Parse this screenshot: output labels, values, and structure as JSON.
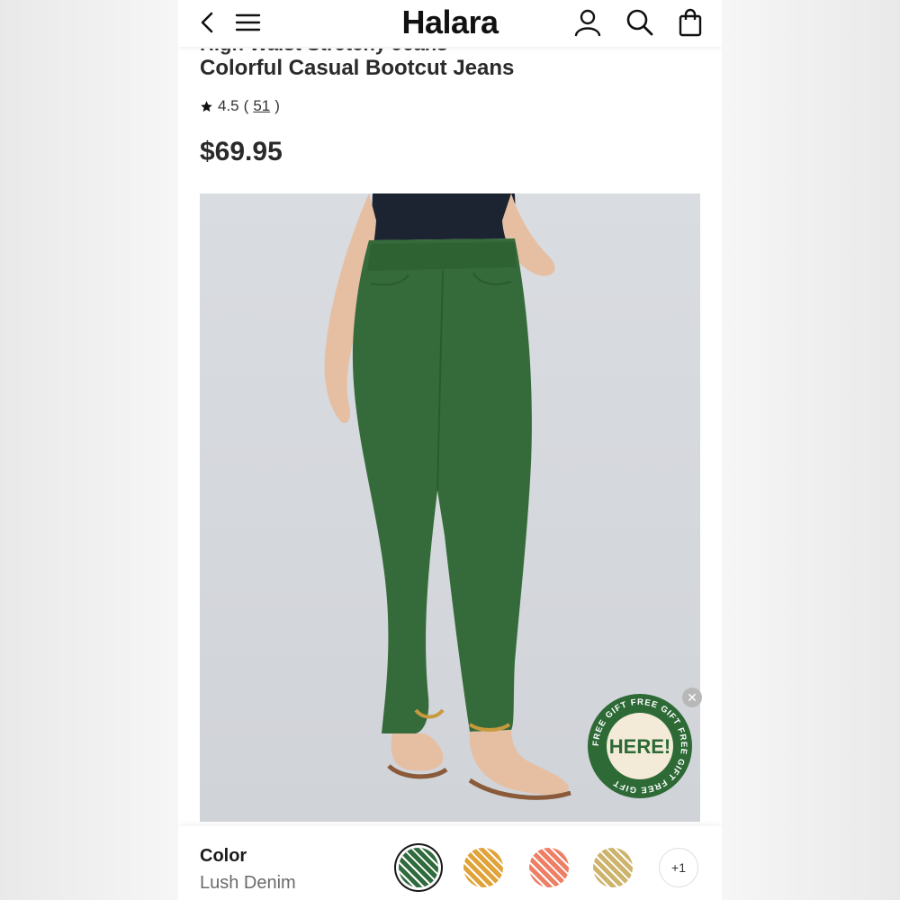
{
  "header": {
    "logo": "Halara"
  },
  "product": {
    "title_partial": "High Waist Stretchy Jeans",
    "title": "Colorful Casual Bootcut Jeans",
    "rating": "4.5",
    "rating_open": "(",
    "review_count": "51",
    "rating_close": ")",
    "price": "$69.95"
  },
  "promo": {
    "badge_text": "HERE!",
    "ring_text": "FREE GIFT FREE GIFT FREE GIFT FREE GIFT"
  },
  "color_selector": {
    "label": "Color",
    "selected_value": "Lush Denim",
    "swatches": [
      {
        "name": "Lush Denim",
        "color": "#2f6b3c",
        "selected": true
      },
      {
        "name": "Mustard",
        "color": "#e0a33a",
        "selected": false
      },
      {
        "name": "Coral",
        "color": "#ee7f65",
        "selected": false
      },
      {
        "name": "Khaki",
        "color": "#cdb36b",
        "selected": false
      }
    ],
    "more_label": "+1"
  },
  "colors": {
    "pants_green": "#356b3a",
    "accent_green": "#2d6a36",
    "photo_bg": "#d6d9dd"
  }
}
